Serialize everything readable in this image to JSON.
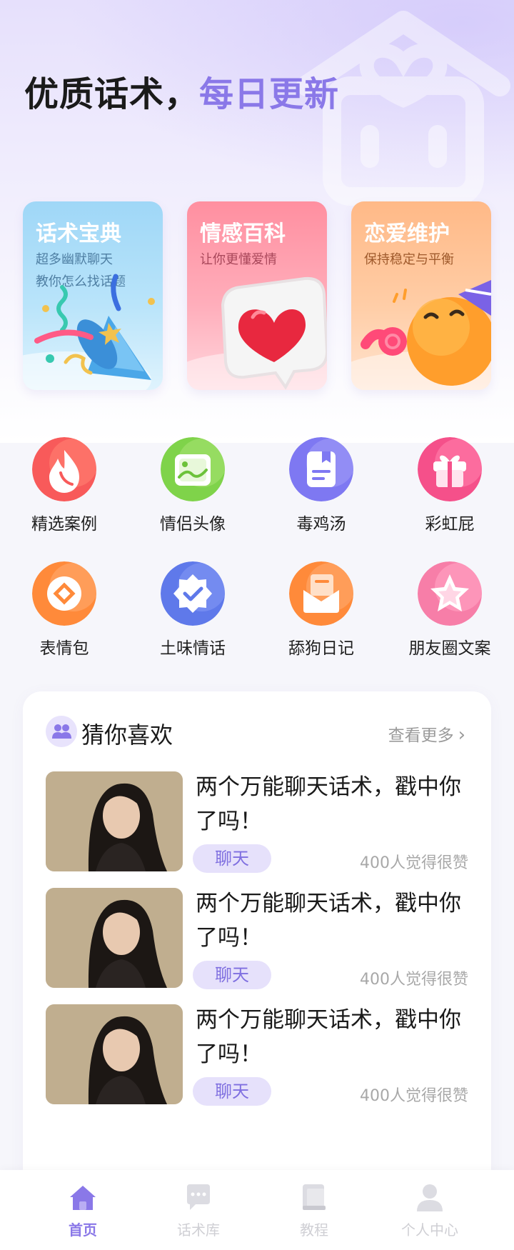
{
  "hero": {
    "title_part1": "优质话术，",
    "title_part2": "每日更新"
  },
  "feature_cards": [
    {
      "title": "话术宝典",
      "subtitle_line1": "超多幽默聊天",
      "subtitle_line2": "教你怎么找话题"
    },
    {
      "title": "情感百科",
      "subtitle_line1": "让你更懂爱情",
      "subtitle_line2": ""
    },
    {
      "title": "恋爱维护",
      "subtitle_line1": "保持稳定与平衡",
      "subtitle_line2": ""
    }
  ],
  "categories": [
    {
      "label": "精选案例",
      "icon": "flame-icon"
    },
    {
      "label": "情侣头像",
      "icon": "picture-icon"
    },
    {
      "label": "毒鸡汤",
      "icon": "notebook-icon"
    },
    {
      "label": "彩虹屁",
      "icon": "gift-icon"
    },
    {
      "label": "表情包",
      "icon": "diamond-badge-icon"
    },
    {
      "label": "土味情话",
      "icon": "check-badge-icon"
    },
    {
      "label": "舔狗日记",
      "icon": "envelope-icon"
    },
    {
      "label": "朋友圈文案",
      "icon": "star-icon"
    }
  ],
  "recommend": {
    "title": "猜你喜欢",
    "more_label": "查看更多",
    "items": [
      {
        "title": "两个万能聊天话术，戳中你了吗！",
        "tag": "聊天",
        "likes": "400人觉得很赞"
      },
      {
        "title": "两个万能聊天话术，戳中你了吗！",
        "tag": "聊天",
        "likes": "400人觉得很赞"
      },
      {
        "title": "两个万能聊天话术，戳中你了吗！",
        "tag": "聊天",
        "likes": "400人觉得很赞"
      }
    ]
  },
  "tabbar": {
    "items": [
      {
        "label": "首页",
        "icon": "home-icon",
        "active": true
      },
      {
        "label": "话术库",
        "icon": "chat-icon",
        "active": false
      },
      {
        "label": "教程",
        "icon": "book-icon",
        "active": false
      },
      {
        "label": "个人中心",
        "icon": "user-icon",
        "active": false
      }
    ]
  },
  "colors": {
    "accent": "#8a78e8",
    "tag_bg": "#e6e1fb",
    "card_blue": "#9fd7f7",
    "card_pink": "#ff8fa0",
    "card_orange": "#ffb987"
  }
}
